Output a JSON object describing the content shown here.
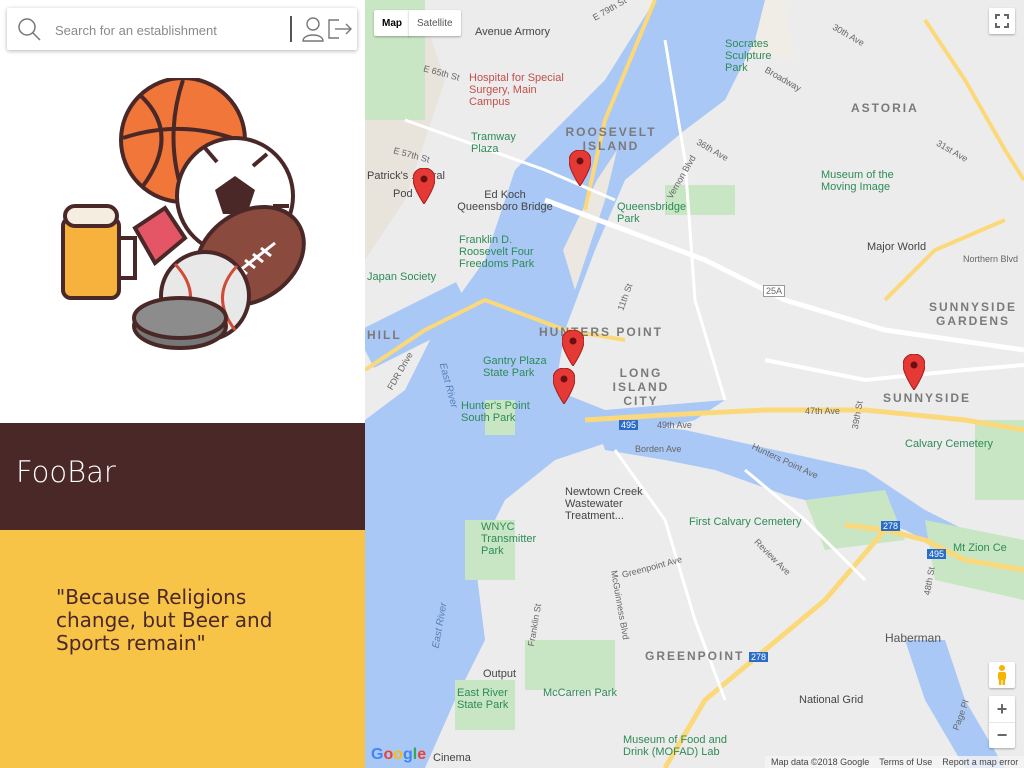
{
  "search": {
    "placeholder": "Search for an establishment"
  },
  "icons": {
    "search": "search-icon",
    "user": "user-icon",
    "logout": "logout-icon",
    "fullscreen": "fullscreen-icon",
    "pegman": "pegman-icon"
  },
  "brand": {
    "name": "FooBar",
    "color": "#4a2828"
  },
  "quote": {
    "text": "\"Because Religions change, but Beer and Sports remain\"",
    "bg": "#f8c448"
  },
  "map": {
    "controls": {
      "map": "Map",
      "satellite": "Satellite",
      "zoom_in": "+",
      "zoom_out": "−"
    },
    "attribution": {
      "data": "Map data ©2018 Google",
      "terms": "Terms of Use",
      "report": "Report a map error"
    },
    "google": [
      "G",
      "o",
      "o",
      "g",
      "l",
      "e"
    ],
    "labels": {
      "roosevelt_island": "ROOSEVELT ISLAND",
      "astoria": "ASTORIA",
      "hunters_point": "HUNTERS POINT",
      "long_island_city": "LONG ISLAND CITY",
      "sunnyside_gardens": "SUNNYSIDE GARDENS",
      "sunnyside": "SUNNYSIDE",
      "greenpoint": "GREENPOINT",
      "haberman": "Haberman",
      "hill": "HILL",
      "socrates": "Socrates Sculpture Park",
      "hospital": "Hospital for Special Surgery, Main Campus",
      "tramway": "Tramway Plaza",
      "edkoch": "Ed Koch Queensboro Bridge",
      "queensbridge": "Queensbridge Park",
      "museum_mi": "Museum of the Moving Image",
      "majorworld": "Major World",
      "fdr": "Franklin D. Roosevelt Four Freedoms Park",
      "japan": "Japan Society",
      "gantry": "Gantry Plaza State Park",
      "hunters_south": "Hunter's Point South Park",
      "calvary": "Calvary Cemetery",
      "newtown": "Newtown Creek Wastewater Treatment...",
      "firstcalvary": "First Calvary Cemetery",
      "wnyc": "WNYC Transmitter Park",
      "mtzion": "Mt Zion Ce",
      "output": "Output",
      "mccarren": "McCarren Park",
      "eastriver_sp": "East River State Park",
      "nationalgrid": "National Grid",
      "mofad": "Museum of Food and Drink (MOFAD) Lab",
      "cinema": "Cinema",
      "avenue_armory": "Avenue Armory",
      "patricks": "Patrick's ...edral",
      "pod": "Pod",
      "east_river": "East River",
      "northern_blvd": "Northern Blvd",
      "greenpoint_ave": "Greenpoint Ave",
      "borden_ave": "Borden Ave",
      "ave49": "49th Ave",
      "ave47": "47th Ave",
      "st36": "36th Ave",
      "st57": "E 57th St",
      "st65": "E 65th St",
      "st79": "E 79th St",
      "broadway": "Broadway",
      "vernon": "Vernon Blvd",
      "st11": "11th St",
      "ave30": "30th Ave",
      "st31": "31st Ave",
      "hpave": "Hunters Point Ave",
      "mcguinness": "McGuinness Blvd",
      "franklin": "Franklin St",
      "review": "Review Ave",
      "page": "Page Pl",
      "st48": "48th St",
      "st39": "39th St",
      "fdr_drive": "FDR Drive",
      "i495": "495",
      "i278": "278",
      "i25a": "25A"
    },
    "pins": [
      "red",
      "red",
      "red",
      "red",
      "red"
    ]
  }
}
